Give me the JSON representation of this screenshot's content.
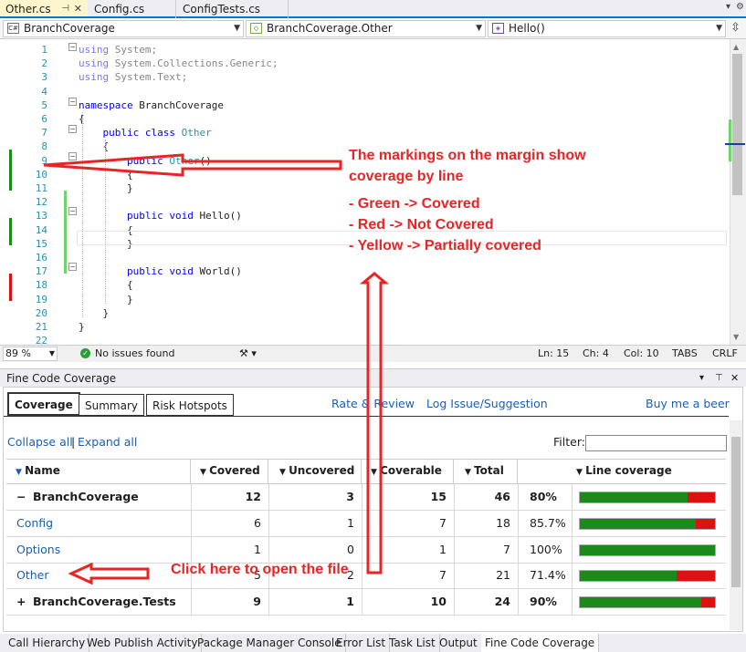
{
  "file_tabs": [
    {
      "label": "Other.cs",
      "active": true
    },
    {
      "label": "Config.cs",
      "active": false
    },
    {
      "label": "ConfigTests.cs",
      "active": false
    }
  ],
  "nav": {
    "project": "BranchCoverage",
    "type": "BranchCoverage.Other",
    "member": "Hello()"
  },
  "code_lines": [
    {
      "n": "1",
      "html": "using System;",
      "dim": true
    },
    {
      "n": "2",
      "html": "using System.Collections.Generic;",
      "dim": true
    },
    {
      "n": "3",
      "html": "using System.Text;",
      "dim": true
    },
    {
      "n": "4",
      "html": ""
    },
    {
      "n": "5",
      "html": "namespace BranchCoverage"
    },
    {
      "n": "6",
      "html": "{"
    },
    {
      "n": "7",
      "html": "    public class Other"
    },
    {
      "n": "8",
      "html": "    {"
    },
    {
      "n": "9",
      "html": "        public Other()"
    },
    {
      "n": "10",
      "html": "        {"
    },
    {
      "n": "11",
      "html": "        }"
    },
    {
      "n": "12",
      "html": ""
    },
    {
      "n": "13",
      "html": "        public void Hello()"
    },
    {
      "n": "14",
      "html": "        {"
    },
    {
      "n": "15",
      "html": "        }"
    },
    {
      "n": "16",
      "html": ""
    },
    {
      "n": "17",
      "html": "        public void World()"
    },
    {
      "n": "18",
      "html": "        {"
    },
    {
      "n": "19",
      "html": "        }"
    },
    {
      "n": "20",
      "html": "    }"
    },
    {
      "n": "21",
      "html": "}"
    },
    {
      "n": "22",
      "html": ""
    }
  ],
  "status": {
    "zoom": "89 %",
    "issues": "No issues found",
    "ln": "Ln: 15",
    "ch": "Ch: 4",
    "col": "Col: 10",
    "tabs": "TABS",
    "eol": "CRLF"
  },
  "tool": {
    "title": "Fine Code Coverage",
    "tabs": [
      "Coverage",
      "Summary",
      "Risk Hotspots"
    ],
    "links": {
      "rate": "Rate & Review",
      "issue": "Log Issue/Suggestion",
      "beer": "Buy me a beer",
      "collapse": "Collapse all",
      "sep": "|",
      "expand": "Expand all"
    },
    "filter_label": "Filter:",
    "columns": [
      "Name",
      "Covered",
      "Uncovered",
      "Coverable",
      "Total",
      "Line coverage"
    ],
    "rows": [
      {
        "expander": "−",
        "name": "BranchCoverage",
        "bold": true,
        "link": false,
        "covered": "12",
        "uncovered": "3",
        "coverable": "15",
        "total": "46",
        "pct": "80%",
        "fraction": 0.8
      },
      {
        "expander": "",
        "name": "Config",
        "bold": false,
        "link": true,
        "covered": "6",
        "uncovered": "1",
        "coverable": "7",
        "total": "18",
        "pct": "85.7%",
        "fraction": 0.857
      },
      {
        "expander": "",
        "name": "Options",
        "bold": false,
        "link": true,
        "covered": "1",
        "uncovered": "0",
        "coverable": "1",
        "total": "7",
        "pct": "100%",
        "fraction": 1.0
      },
      {
        "expander": "",
        "name": "Other",
        "bold": false,
        "link": true,
        "covered": "5",
        "uncovered": "2",
        "coverable": "7",
        "total": "21",
        "pct": "71.4%",
        "fraction": 0.714
      },
      {
        "expander": "+",
        "name": "BranchCoverage.Tests",
        "bold": true,
        "link": false,
        "covered": "9",
        "uncovered": "1",
        "coverable": "10",
        "total": "24",
        "pct": "90%",
        "fraction": 0.9
      }
    ]
  },
  "bottom_tabs": [
    "Call Hierarchy",
    "Web Publish Activity",
    "Package Manager Console",
    "Error List",
    "Task List",
    "Output",
    "Fine Code Coverage"
  ],
  "annotations": {
    "margin_title": "The markings on the margin show",
    "margin_title2": "coverage by line",
    "green": "- Green -> Covered",
    "red": "- Red -> Not Covered",
    "yellow": "- Yellow -> Partially covered",
    "click": "Click here to open the file"
  },
  "colors": {
    "covered": "#1b8a1b",
    "uncovered": "#dd1111",
    "annotation": "#e82424",
    "accent": "#007acc"
  }
}
